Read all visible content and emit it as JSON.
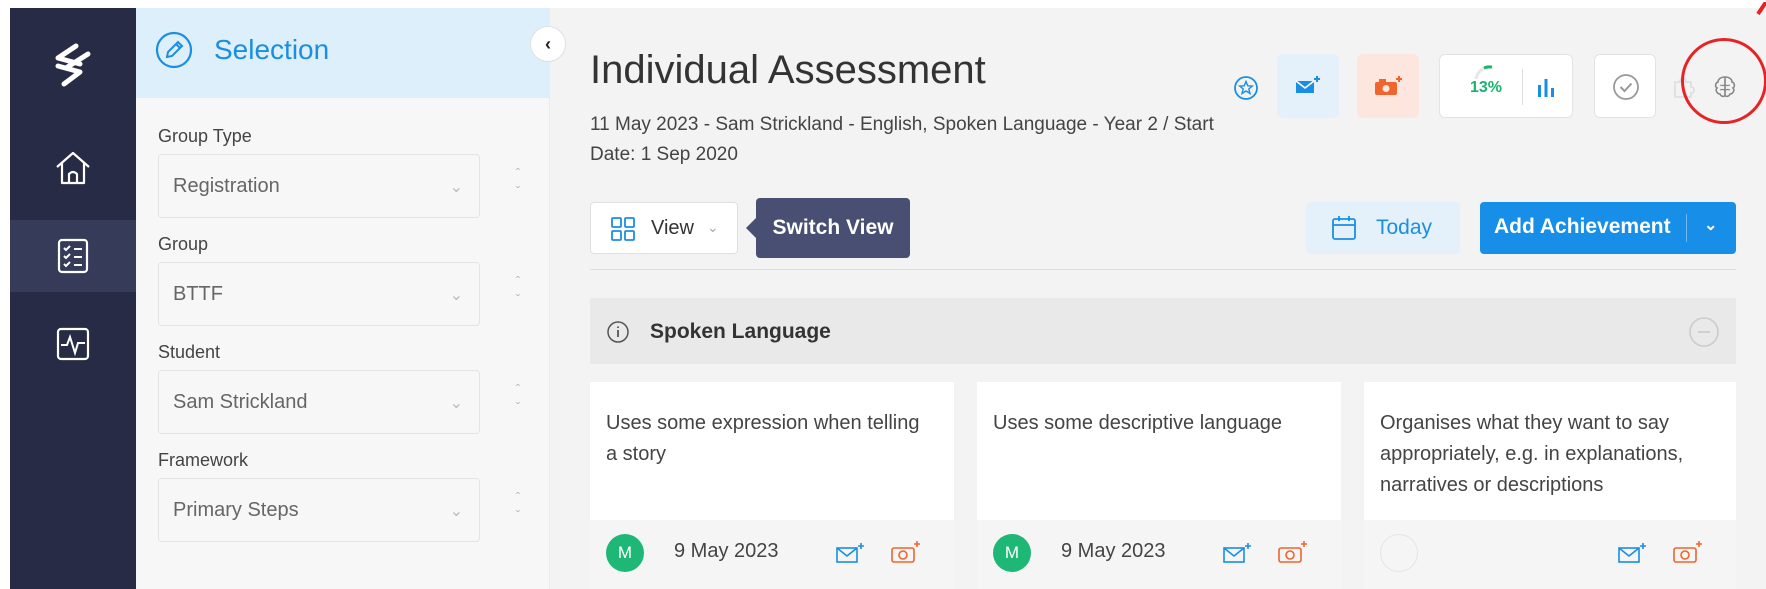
{
  "sidebar": {
    "nav": [
      {
        "icon": "home-icon"
      },
      {
        "icon": "assessment-checklist-icon",
        "active": true
      },
      {
        "icon": "activity-pulse-icon"
      }
    ]
  },
  "panel": {
    "title": "Selection",
    "fields": [
      {
        "label": "Group Type",
        "value": "Registration"
      },
      {
        "label": "Group",
        "value": "BTTF"
      },
      {
        "label": "Student",
        "value": "Sam Strickland"
      },
      {
        "label": "Framework",
        "value": "Primary Steps"
      }
    ]
  },
  "header": {
    "title": "Individual Assessment",
    "subtitle": "11 May 2023 - Sam Strickland - English, Spoken Language - Year 2 / Start Date: 1 Sep 2020",
    "progress_label": "13%",
    "progress_value": 0.13
  },
  "toolbar": {
    "view_label": "View",
    "tooltip": "Switch View",
    "today_label": "Today",
    "add_label": "Add Achievement"
  },
  "section": {
    "title": "Spoken Language"
  },
  "cards": [
    {
      "text": "Uses some expression when telling a story",
      "avatar": "M",
      "date": "9 May 2023"
    },
    {
      "text": "Uses some descriptive language",
      "avatar": "M",
      "date": "9 May 2023"
    },
    {
      "text": "Organises what they want to say appropriately, e.g. in explanations, narratives or descriptions",
      "avatar": "",
      "date": ""
    }
  ],
  "colors": {
    "rail": "#272b45",
    "accent_blue": "#178ee8",
    "accent_orange": "#f0642d",
    "progress_green": "#18b46f",
    "annotation_red": "#e52525"
  }
}
